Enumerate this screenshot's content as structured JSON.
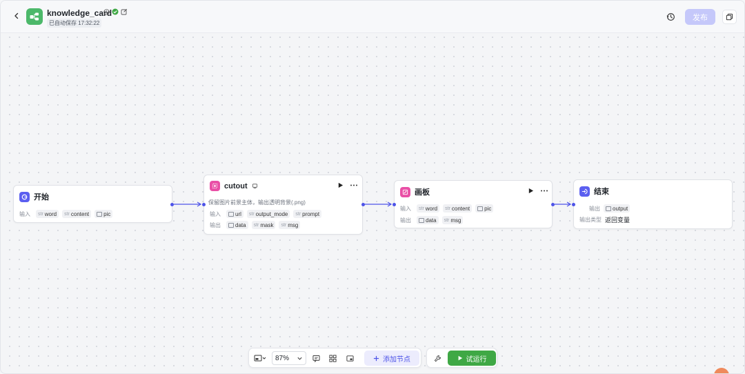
{
  "header": {
    "title": "knowledge_card",
    "save_status": "已自动保存 17:32:22",
    "publish_label": "发布"
  },
  "nodes": {
    "start": {
      "title": "开始",
      "input_label": "输入",
      "inputs": [
        {
          "type": "str",
          "name": "word"
        },
        {
          "type": "str",
          "name": "content"
        },
        {
          "type": "pic",
          "name": "pic"
        }
      ]
    },
    "cutout": {
      "title": "cutout",
      "description": "保留图片前景主体，输出透明背景(.png)",
      "input_label": "输入",
      "output_label": "输出",
      "inputs": [
        {
          "type": "pic",
          "name": "url"
        },
        {
          "type": "str",
          "name": "output_mode"
        },
        {
          "type": "str",
          "name": "prompt"
        }
      ],
      "outputs": [
        {
          "type": "pic",
          "name": "data"
        },
        {
          "type": "str",
          "name": "mask"
        },
        {
          "type": "str",
          "name": "msg"
        }
      ]
    },
    "canvas": {
      "title": "画板",
      "input_label": "输入",
      "output_label": "输出",
      "inputs": [
        {
          "type": "str",
          "name": "word"
        },
        {
          "type": "str",
          "name": "content"
        },
        {
          "type": "pic",
          "name": "pic"
        }
      ],
      "outputs": [
        {
          "type": "pic",
          "name": "data"
        },
        {
          "type": "str",
          "name": "msg"
        }
      ]
    },
    "end": {
      "title": "结束",
      "output_label": "输出",
      "output_type_label": "输出类型",
      "outputs": [
        {
          "type": "pic",
          "name": "output"
        }
      ],
      "output_type_value": "返回变量"
    }
  },
  "toolbar": {
    "zoom": "87%",
    "add_node_label": "添加节点",
    "run_label": "试运行"
  },
  "colors": {
    "accent": "#4d53e8",
    "run_green": "#3fa845",
    "publish_disabled": "#c5c8fa",
    "start_icon": "#5b5ff0",
    "cutout_icon": "#e94fa6",
    "canvas_icon": "#e94fa6",
    "end_icon": "#5b5ff0",
    "logo_green": "#4cb86a"
  }
}
